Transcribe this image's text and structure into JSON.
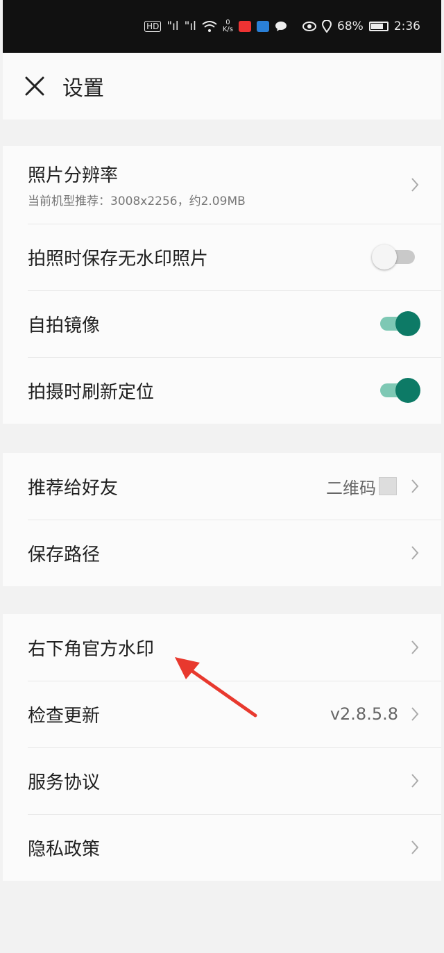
{
  "status_bar": {
    "signal1": "\"ıl",
    "signal2": "\"ıl",
    "network_speed": "0\nK/s",
    "battery_percent": "68%",
    "time": "2:36"
  },
  "header": {
    "title": "设置",
    "close_icon": "close-icon"
  },
  "group1": {
    "resolution": {
      "label": "照片分辨率",
      "subtitle": "当前机型推荐：3008x2256，约2.09MB"
    },
    "save_no_watermark": {
      "label": "拍照时保存无水印照片",
      "enabled": false
    },
    "selfie_mirror": {
      "label": "自拍镜像",
      "enabled": true
    },
    "refresh_location": {
      "label": "拍摄时刷新定位",
      "enabled": true
    }
  },
  "group2": {
    "recommend": {
      "label": "推荐给好友",
      "value": "二维码"
    },
    "save_path": {
      "label": "保存路径"
    }
  },
  "group3": {
    "official_watermark": {
      "label": "右下角官方水印"
    },
    "check_update": {
      "label": "检查更新",
      "value": "v2.8.5.8"
    },
    "service_agreement": {
      "label": "服务协议"
    },
    "privacy_policy": {
      "label": "隐私政策"
    }
  },
  "colors": {
    "toggle_on_knob": "#0d7a66",
    "toggle_on_track": "#7ec8b4",
    "annotation_arrow": "#e8392e"
  }
}
